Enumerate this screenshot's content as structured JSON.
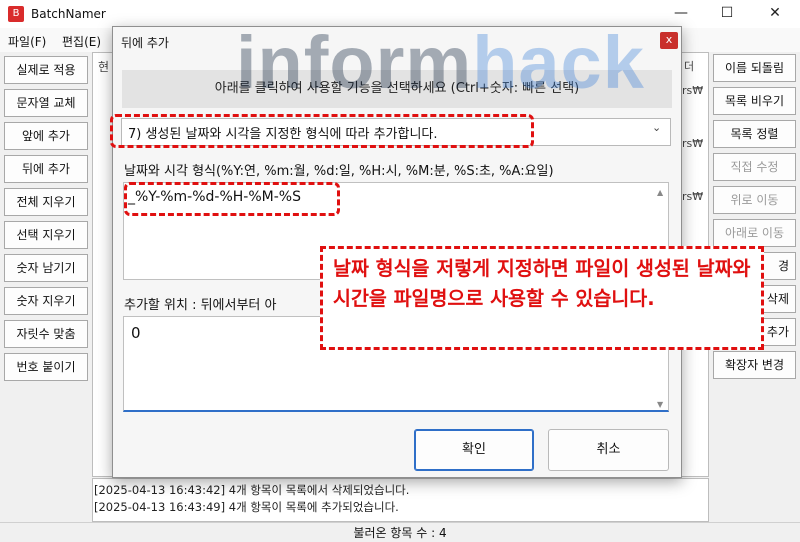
{
  "window": {
    "title": "BatchNamer",
    "app_icon": "batchnamer-logo-icon",
    "controls": {
      "minimize": "—",
      "maximize": "☐",
      "close": "✕"
    }
  },
  "menu": {
    "file": "파일(F)",
    "edit": "편집(E)"
  },
  "left_buttons": [
    {
      "label": "실제로 적용"
    },
    {
      "label": "문자열 교체"
    },
    {
      "label": "앞에 추가"
    },
    {
      "label": "뒤에 추가"
    },
    {
      "label": "전체 지우기"
    },
    {
      "label": "선택 지우기"
    },
    {
      "label": "숫자 남기기"
    },
    {
      "label": "숫자 지우기"
    },
    {
      "label": "자릿수 맞춤"
    },
    {
      "label": "번호 붙이기"
    }
  ],
  "right_buttons": [
    {
      "label": "이름 되돌림",
      "enabled": true
    },
    {
      "label": "목록 비우기",
      "enabled": true
    },
    {
      "label": "목록 정렬",
      "enabled": true
    },
    {
      "label": "직접 수정",
      "enabled": false
    },
    {
      "label": "위로 이동",
      "enabled": false
    },
    {
      "label": "아래로 이동",
      "enabled": false
    },
    {
      "label": "경",
      "enabled": true
    },
    {
      "label": "삭제",
      "enabled": true
    },
    {
      "label": "추가",
      "enabled": true
    },
    {
      "label": "확장자 변경",
      "enabled": true
    }
  ],
  "file_list": {
    "header_peek": "현",
    "right_peek": [
      "더",
      "rs₩",
      "rs₩",
      "rs₩"
    ]
  },
  "log": [
    "[2025-04-13 16:43:42] 4개 항목이 목록에서 삭제되었습니다.",
    "[2025-04-13 16:43:49] 4개 항목이 목록에 추가되었습니다."
  ],
  "status": {
    "loaded_count": "불러온 항목 수 : 4"
  },
  "dialog": {
    "title": "뒤에 추가",
    "close": "x",
    "instruction": "아래를 클릭하여 사용할 기능을 선택하세요 (Ctrl+숫자: 빠른 선택)",
    "selected_option": "7) 생성된 날짜와 시각을 지정한 형식에 따라 추가합니다.",
    "format_label": "날짜와 시각 형식(%Y:연, %m:월, %d:일, %H:시, %M:분, %S:초, %A:요일)",
    "format_value": "_%Y-%m-%d-%H-%M-%S",
    "position_label": "추가할 위치 : 뒤에서부터 아",
    "position_value": "0",
    "ok": "확인",
    "cancel": "취소"
  },
  "annotation": {
    "callout": "날짜 형식을 저렇게 지정하면 파일이 생성된 날짜와 시간을 파일명으로 사용할 수 있습니다.",
    "highlight_color": "#e01010"
  },
  "watermark": {
    "part1": "inform",
    "part2": "hack",
    "color1": "#0b1f3a",
    "color2": "#3a7fd9"
  }
}
